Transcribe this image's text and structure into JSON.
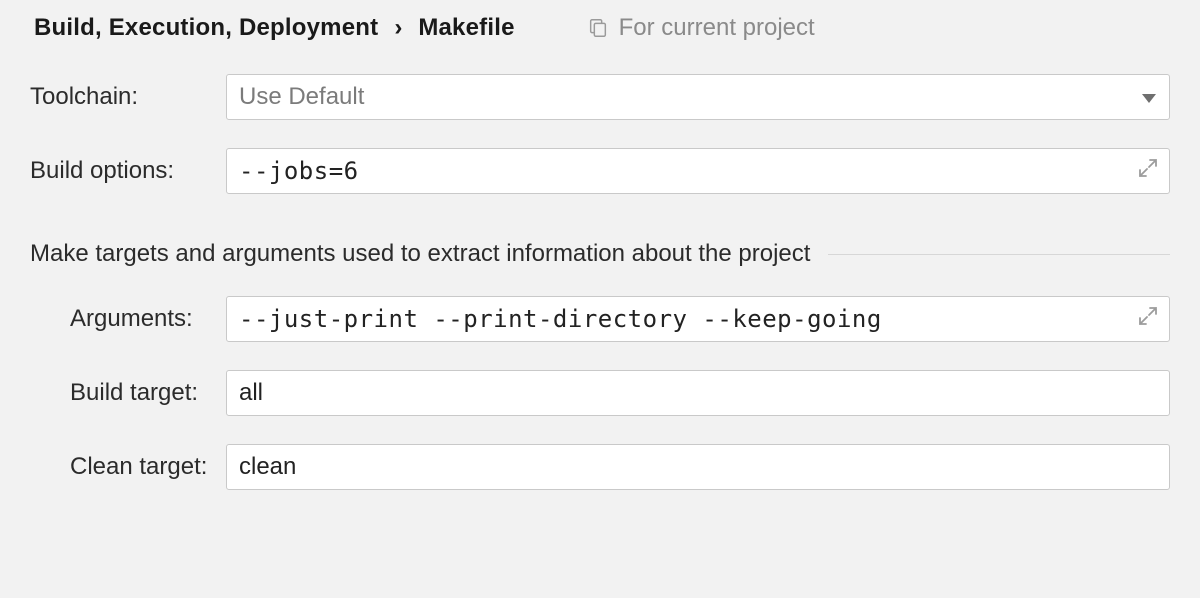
{
  "breadcrumb": {
    "parent": "Build, Execution, Deployment",
    "current": "Makefile"
  },
  "scope_label": "For current project",
  "labels": {
    "toolchain": "Toolchain:",
    "build_options": "Build options:",
    "arguments": "Arguments:",
    "build_target": "Build target:",
    "clean_target": "Clean target:"
  },
  "values": {
    "toolchain": "Use Default",
    "build_options": "--jobs=6",
    "arguments": "--just-print --print-directory --keep-going",
    "build_target": "all",
    "clean_target": "clean"
  },
  "section_title": "Make targets and arguments used to extract information about the project"
}
